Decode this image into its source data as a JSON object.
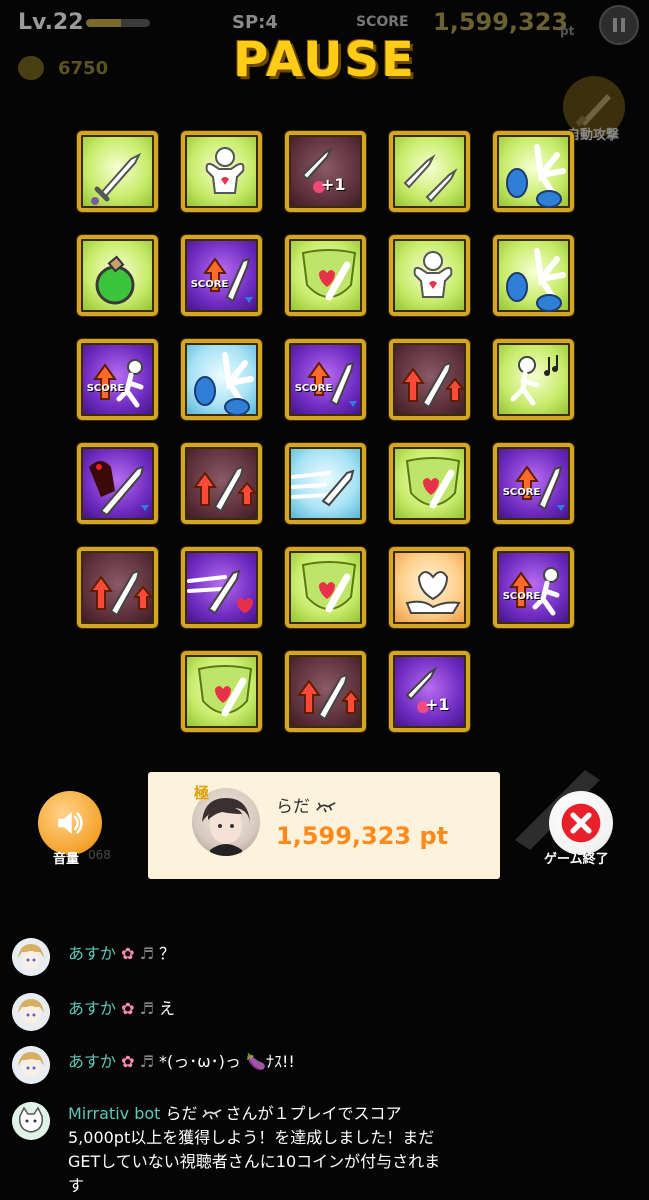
{
  "hud": {
    "level": "Lv.22",
    "level_progress": 0.55,
    "sp": "SP:4",
    "score_label": "SCORE",
    "score_value": "1,599,323",
    "score_unit": "pt",
    "coins": "6750"
  },
  "title": "PAUSE",
  "auto_attack_label": "自動攻撃",
  "skills": [
    [
      {
        "bg": "green",
        "icon": "sword-icon"
      },
      {
        "bg": "green",
        "icon": "flex-strength-icon"
      },
      {
        "bg": "maroon",
        "icon": "critical-plus-one-icon",
        "plus": "+1"
      },
      {
        "bg": "green",
        "icon": "double-sword-icon"
      },
      {
        "bg": "green",
        "icon": "flail-claws-icon"
      }
    ],
    [
      {
        "bg": "green",
        "icon": "potion-icon"
      },
      {
        "bg": "purple",
        "icon": "score-up-sword-down-icon",
        "score": "SCORE"
      },
      {
        "bg": "green",
        "icon": "heart-shield-icon"
      },
      {
        "bg": "green",
        "icon": "flex-strength-icon"
      },
      {
        "bg": "green",
        "icon": "flail-claws-icon"
      }
    ],
    [
      {
        "bg": "purple",
        "icon": "score-up-runner-icon",
        "score": "SCORE"
      },
      {
        "bg": "blue",
        "icon": "flail-claws-icon"
      },
      {
        "bg": "purple",
        "icon": "score-up-sword-down-icon",
        "score": "SCORE"
      },
      {
        "bg": "maroon",
        "icon": "attack-up-icon"
      },
      {
        "bg": "green",
        "icon": "runner-music-icon"
      }
    ],
    [
      {
        "bg": "purple",
        "icon": "demon-sword-icon"
      },
      {
        "bg": "maroon",
        "icon": "attack-up-icon"
      },
      {
        "bg": "blue",
        "icon": "dash-sword-icon"
      },
      {
        "bg": "green",
        "icon": "heart-shield-icon"
      },
      {
        "bg": "purple",
        "icon": "score-up-sword-down-icon",
        "score": "SCORE"
      }
    ],
    [
      {
        "bg": "maroon",
        "icon": "attack-up-icon"
      },
      {
        "bg": "purple",
        "icon": "dash-sword-heart-icon"
      },
      {
        "bg": "green",
        "icon": "heart-shield-icon"
      },
      {
        "bg": "orange",
        "icon": "heart-hand-icon"
      },
      {
        "bg": "purple",
        "icon": "score-up-runner-icon",
        "score": "SCORE"
      }
    ],
    [
      {
        "bg": "green",
        "icon": "heart-shield-icon"
      },
      {
        "bg": "maroon",
        "icon": "attack-up-icon"
      },
      {
        "bg": "purple",
        "icon": "critical-plus-one-icon",
        "plus": "+1"
      }
    ]
  ],
  "player_card": {
    "badge": "極",
    "name": "らだ",
    "score": "1,599,323 pt"
  },
  "volume_label": "音量",
  "volume_bg_number": "068",
  "end_game_label": "ゲーム終了",
  "chat": [
    {
      "name": "あすか",
      "text": "？"
    },
    {
      "name": "あすか",
      "text": "え"
    },
    {
      "name": "あすか",
      "text": "*(っ･ω･)っ",
      "suffix": "ﾅｽ!!"
    }
  ],
  "bot": {
    "name": "Mirrativ bot",
    "lines": [
      "らだ",
      "さんが１プレイでスコア",
      "5,000pt以上を獲得しよう！を達成しました！まだ",
      "GETしていない視聴者さんに10コインが付与されま",
      "す"
    ]
  },
  "colors": {
    "gold_title": "#ffcc18",
    "chat_name": "#5bc9b8",
    "card_score": "#ff8a1a",
    "slot_border": "#d4a621"
  }
}
